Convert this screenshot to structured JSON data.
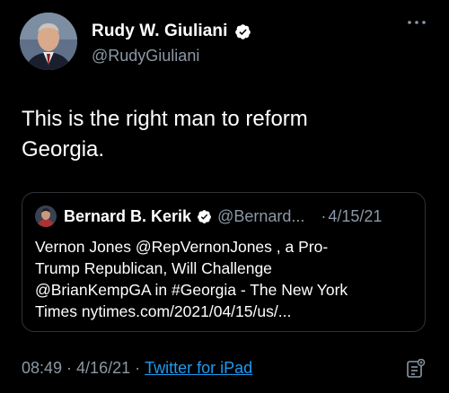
{
  "tweet": {
    "author_name": "Rudy W. Giuliani",
    "author_handle": "@RudyGiuliani",
    "text": "This is the right man to reform\nGeorgia.",
    "time": "08:49",
    "date": "4/16/21",
    "separator": "·",
    "source": "Twitter for iPad",
    "verified_icon": "verified-badge-icon",
    "more_icon": "more-options-icon",
    "analytics_icon": "analytics-icon"
  },
  "quote": {
    "author_name": "Bernard B. Kerik",
    "author_handle": "@Bernard...",
    "separator": "·",
    "date": "4/15/21",
    "text": "Vernon Jones @RepVernonJones , a Pro-\nTrump Republican, Will Challenge\n@BrianKempGA in #Georgia - The New York\nTimes nytimes.com/2021/04/15/us/...",
    "verified_icon": "verified-badge-icon"
  },
  "colors": {
    "background": "#000000",
    "text": "#ffffff",
    "secondary": "#8b98a5",
    "link": "#1d9bf0",
    "border": "#2f3336"
  }
}
